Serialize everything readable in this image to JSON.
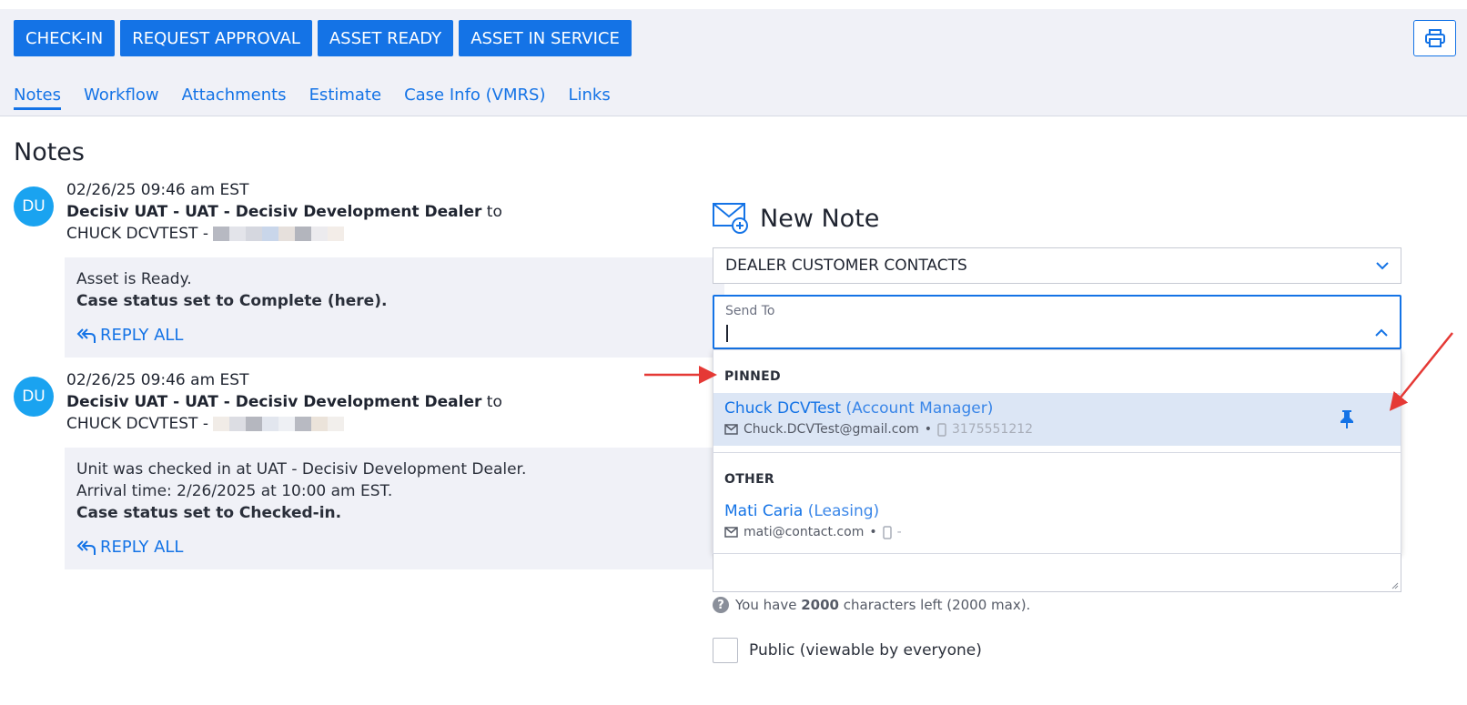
{
  "toolbar": {
    "buttons": [
      "CHECK-IN",
      "REQUEST APPROVAL",
      "ASSET READY",
      "ASSET IN SERVICE"
    ]
  },
  "tabs": [
    "Notes",
    "Workflow",
    "Attachments",
    "Estimate",
    "Case Info (VMRS)",
    "Links"
  ],
  "page_title": "Notes",
  "notes": [
    {
      "avatar": "DU",
      "timestamp": "02/26/25 09:46 am EST",
      "from": "Decisiv UAT - UAT - Decisiv Development Dealer",
      "to_word": "to",
      "recipient": "CHUCK DCVTEST -",
      "lines": [
        "Asset is Ready."
      ],
      "bold_line": "Case status set to Complete (here).",
      "reply": "REPLY ALL"
    },
    {
      "avatar": "DU",
      "timestamp": "02/26/25 09:46 am EST",
      "from": "Decisiv UAT - UAT - Decisiv Development Dealer",
      "to_word": "to",
      "recipient": "CHUCK DCVTEST -",
      "lines": [
        "Unit  was checked in at UAT - Decisiv Development Dealer.",
        "Arrival time: 2/26/2025 at 10:00 am EST."
      ],
      "bold_line": "Case status set to Checked-in.",
      "reply": "REPLY ALL"
    }
  ],
  "new_note": {
    "title": "New Note",
    "contact_select": "DEALER CUSTOMER CONTACTS",
    "send_to_label": "Send To",
    "send_to_value": "",
    "dropdown": {
      "pinned_header": "PINNED",
      "pinned": {
        "name": "Chuck DCVTest",
        "role": "(Account Manager)",
        "email": "Chuck.DCVTest@gmail.com",
        "phone": "3175551212"
      },
      "other_header": "OTHER",
      "other": {
        "name": "Mati Caria",
        "role": "(Leasing)",
        "email": "mati@contact.com",
        "phone": "-"
      },
      "separator": "•"
    },
    "chars_prefix": "You have",
    "chars_count": "2000",
    "chars_suffix": "characters left (2000 max).",
    "public_label": "Public (viewable by everyone)"
  },
  "colors": {
    "primary": "#1473e6",
    "avatar": "#1aa3f0",
    "pinned_highlight": "#dce6f5",
    "annotation_arrow": "#e53935"
  }
}
